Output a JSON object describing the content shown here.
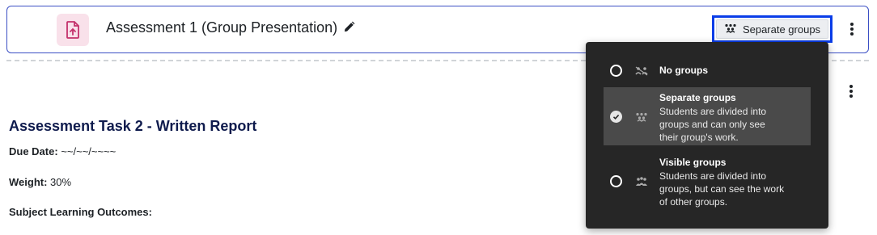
{
  "activity": {
    "title": "Assessment 1 (Group Presentation)",
    "icon": "assignment-upload-icon",
    "groups_button_label": "Separate groups"
  },
  "section": {
    "title": "Assessment Task 2 - Written Report",
    "due_date_label": "Due Date:",
    "due_date_value": "~~/~~/~~~~",
    "weight_label": "Weight:",
    "weight_value": "30%",
    "outcomes_label": "Subject Learning Outcomes:"
  },
  "group_menu": {
    "options": [
      {
        "label": "No groups",
        "description": [],
        "selected": false
      },
      {
        "label": "Separate groups",
        "description": [
          "Students are divided into",
          "groups and can only see",
          "their group's work."
        ],
        "selected": true
      },
      {
        "label": "Visible groups",
        "description": [
          "Students are divided into",
          "groups, but can see the work",
          "of other groups."
        ],
        "selected": false
      }
    ]
  },
  "colors": {
    "accent_border": "#3b4fc4",
    "focus_ring": "#0a3de8",
    "menu_bg": "#262626",
    "menu_selected_bg": "#4a4a4a",
    "icon_bg": "#f9e1ea",
    "icon_fg": "#c4316b",
    "heading": "#0f1b4d"
  }
}
